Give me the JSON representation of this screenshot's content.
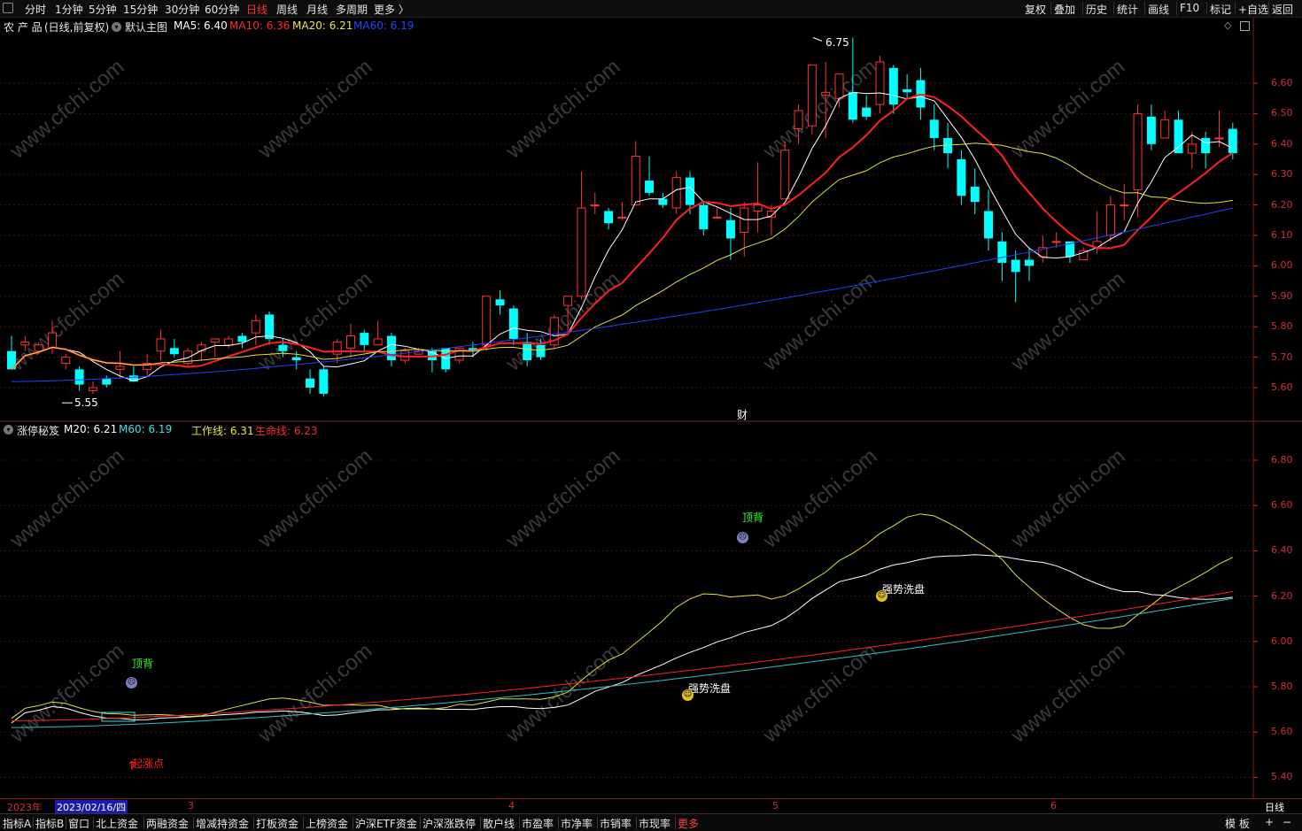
{
  "toolbar": {
    "periods": [
      "分时",
      "1分钟",
      "5分钟",
      "15分钟",
      "30分钟",
      "60分钟",
      "日线",
      "周线",
      "月线",
      "多周期",
      "更多 〉"
    ],
    "active_period": "日线",
    "right_buttons": [
      "复权",
      "叠加",
      "历史",
      "统计",
      "画线",
      "F10",
      "标记",
      "+自选",
      "返回"
    ]
  },
  "main_header": {
    "stock": "农 产 品",
    "mode": "(日线,前复权)",
    "template": "默认主图",
    "ma5": "MA5: 6.40",
    "ma10": "MA10: 6.36",
    "ma20": "MA20: 6.21",
    "ma60": "MA60: 6.19",
    "high_mark": "6.75",
    "low_mark": "5.55",
    "finance_mark": "财"
  },
  "sub_header": {
    "indicator": "涨停秘笈",
    "m20": "M20: 6.21",
    "m60": "M60: 6.19",
    "work_line": "工作线: 6.31",
    "life_line": "生命线: 6.23"
  },
  "sub_annotations": {
    "top_divergence_1": "顶背",
    "top_divergence_2": "顶背",
    "wash_1": "强势洗盘",
    "wash_2": "强势洗盘",
    "start_point": "起涨点"
  },
  "main_axis": [
    "6.60",
    "6.50",
    "6.40",
    "6.30",
    "6.20",
    "6.10",
    "6.00",
    "5.90",
    "5.80",
    "5.70",
    "5.60"
  ],
  "sub_axis": [
    "6.80",
    "6.60",
    "6.40",
    "6.20",
    "6.00",
    "5.80",
    "5.60",
    "5.40"
  ],
  "datebar": {
    "year": "2023年",
    "cursor_date": "2023/02/16/四",
    "months": [
      "3",
      "4",
      "5",
      "6"
    ],
    "period": "日线"
  },
  "bottombar": {
    "tabs": [
      "指标A",
      "指标B",
      "窗口",
      "北上资金",
      "两融资金",
      "增减持资金",
      "打板资金",
      "上榜资金",
      "沪深ETF资金",
      "沪深涨跌停",
      "散户线",
      "市盈率",
      "市净率",
      "市销率",
      "市现率",
      "更多"
    ],
    "right": [
      "模 板",
      "+",
      "−"
    ]
  },
  "watermark": "www.cfchi.com",
  "colors": {
    "up": "#ff3333",
    "down": "#00ffff",
    "ma5": "#ffffff",
    "ma10": "#ff2020",
    "ma20": "#e0e040",
    "ma60": "#2040ff",
    "grid": "#4a0c0c",
    "axis": "#d03030"
  },
  "chart_data": {
    "type": "candlestick",
    "title": "农 产 品 (日线,前复权)",
    "candles": [
      [
        5.72,
        5.66,
        5.71,
        5.77
      ],
      [
        5.74,
        5.75,
        5.72,
        5.77
      ],
      [
        5.72,
        5.74,
        5.71,
        5.75
      ],
      [
        5.73,
        5.78,
        5.71,
        5.82
      ],
      [
        5.68,
        5.7,
        5.66,
        5.71
      ],
      [
        5.66,
        5.61,
        5.59,
        5.67
      ],
      [
        5.59,
        5.6,
        5.58,
        5.62
      ],
      [
        5.63,
        5.61,
        5.6,
        5.64
      ],
      [
        5.66,
        5.67,
        5.63,
        5.72
      ],
      [
        5.64,
        5.62,
        5.63,
        5.67
      ],
      [
        5.66,
        5.68,
        5.64,
        5.71
      ],
      [
        5.72,
        5.76,
        5.69,
        5.79
      ],
      [
        5.73,
        5.71,
        5.7,
        5.76
      ],
      [
        5.68,
        5.72,
        5.67,
        5.73
      ],
      [
        5.72,
        5.74,
        5.69,
        5.75
      ],
      [
        5.75,
        5.76,
        5.7,
        5.75
      ],
      [
        5.74,
        5.76,
        5.73,
        5.77
      ],
      [
        5.77,
        5.75,
        5.73,
        5.78
      ],
      [
        5.78,
        5.82,
        5.74,
        5.84
      ],
      [
        5.84,
        5.76,
        5.74,
        5.85
      ],
      [
        5.74,
        5.72,
        5.7,
        5.76
      ],
      [
        5.7,
        5.69,
        5.66,
        5.72
      ],
      [
        5.63,
        5.6,
        5.58,
        5.66
      ],
      [
        5.66,
        5.58,
        5.57,
        5.67
      ],
      [
        5.71,
        5.75,
        5.68,
        5.76
      ],
      [
        5.73,
        5.77,
        5.7,
        5.81
      ],
      [
        5.78,
        5.74,
        5.72,
        5.79
      ],
      [
        5.74,
        5.76,
        5.74,
        5.82
      ],
      [
        5.77,
        5.69,
        5.67,
        5.78
      ],
      [
        5.69,
        5.72,
        5.68,
        5.73
      ],
      [
        5.71,
        5.72,
        5.71,
        5.73
      ],
      [
        5.72,
        5.69,
        5.65,
        5.73
      ],
      [
        5.73,
        5.66,
        5.65,
        5.73
      ],
      [
        5.69,
        5.73,
        5.68,
        5.73
      ],
      [
        5.73,
        5.72,
        5.7,
        5.75
      ],
      [
        5.74,
        5.9,
        5.72,
        5.9
      ],
      [
        5.89,
        5.87,
        5.84,
        5.92
      ],
      [
        5.86,
        5.76,
        5.74,
        5.87
      ],
      [
        5.75,
        5.69,
        5.67,
        5.78
      ],
      [
        5.74,
        5.7,
        5.69,
        5.76
      ],
      [
        5.74,
        5.83,
        5.73,
        5.84
      ],
      [
        5.87,
        5.9,
        5.77,
        5.9
      ],
      [
        5.9,
        6.19,
        5.89,
        6.31
      ],
      [
        6.2,
        6.2,
        6.17,
        6.24
      ],
      [
        6.18,
        6.14,
        6.12,
        6.19
      ],
      [
        6.16,
        6.16,
        6.15,
        6.21
      ],
      [
        6.2,
        6.36,
        6.2,
        6.41
      ],
      [
        6.28,
        6.24,
        6.23,
        6.36
      ],
      [
        6.22,
        6.2,
        6.19,
        6.24
      ],
      [
        6.19,
        6.29,
        6.17,
        6.31
      ],
      [
        6.29,
        6.2,
        6.17,
        6.31
      ],
      [
        6.2,
        6.12,
        6.1,
        6.21
      ],
      [
        6.16,
        6.16,
        6.16,
        6.19
      ],
      [
        6.15,
        6.09,
        6.02,
        6.19
      ],
      [
        6.11,
        6.19,
        6.03,
        6.21
      ],
      [
        6.18,
        6.2,
        6.11,
        6.34
      ],
      [
        6.16,
        6.18,
        6.1,
        6.2
      ],
      [
        6.22,
        6.38,
        6.22,
        6.41
      ],
      [
        6.45,
        6.51,
        6.4,
        6.53
      ],
      [
        6.46,
        6.66,
        6.43,
        6.66
      ],
      [
        6.56,
        6.57,
        6.42,
        6.67
      ],
      [
        6.55,
        6.63,
        6.52,
        6.63
      ],
      [
        6.57,
        6.48,
        6.47,
        6.75
      ],
      [
        6.52,
        6.49,
        6.48,
        6.56
      ],
      [
        6.53,
        6.67,
        6.5,
        6.69
      ],
      [
        6.65,
        6.53,
        6.5,
        6.66
      ],
      [
        6.58,
        6.57,
        6.55,
        6.63
      ],
      [
        6.61,
        6.52,
        6.48,
        6.65
      ],
      [
        6.48,
        6.42,
        6.38,
        6.53
      ],
      [
        6.42,
        6.37,
        6.32,
        6.47
      ],
      [
        6.35,
        6.23,
        6.2,
        6.38
      ],
      [
        6.26,
        6.21,
        6.17,
        6.32
      ],
      [
        6.18,
        6.09,
        6.05,
        6.25
      ],
      [
        6.08,
        6.01,
        5.95,
        6.11
      ],
      [
        6.02,
        5.98,
        5.88,
        6.05
      ],
      [
        6.02,
        6.0,
        5.95,
        6.06
      ],
      [
        6.03,
        6.06,
        6.01,
        6.1
      ],
      [
        6.08,
        6.08,
        6.06,
        6.11
      ],
      [
        6.08,
        6.03,
        6.01,
        6.08
      ],
      [
        6.02,
        6.05,
        6.02,
        6.06
      ],
      [
        6.06,
        6.08,
        6.04,
        6.18
      ],
      [
        6.1,
        6.2,
        6.08,
        6.23
      ],
      [
        6.2,
        6.2,
        6.15,
        6.27
      ],
      [
        6.25,
        6.5,
        6.16,
        6.53
      ],
      [
        6.49,
        6.4,
        6.38,
        6.53
      ],
      [
        6.42,
        6.48,
        6.42,
        6.51
      ],
      [
        6.48,
        6.37,
        6.37,
        6.51
      ],
      [
        6.37,
        6.4,
        6.32,
        6.44
      ],
      [
        6.42,
        6.37,
        6.32,
        6.44
      ],
      [
        6.42,
        6.42,
        6.39,
        6.51
      ],
      [
        6.45,
        6.37,
        6.35,
        6.47
      ]
    ]
  }
}
